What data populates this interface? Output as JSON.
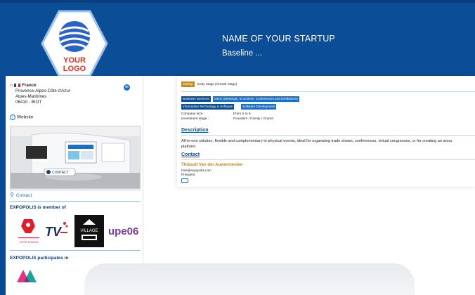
{
  "header": {
    "logo_text_line1": "YOUR",
    "logo_text_line2": "LOGO",
    "startup_name": "NAME OF YOUR STARTUP",
    "baseline": "Baseline ..."
  },
  "sidebar": {
    "country": "France",
    "region": "Provence-Alpes-Côte d'Azur",
    "department": "Alpes-Maritimes",
    "postcode_city": "06410 - BIOT",
    "linkedin_label": "in",
    "website_label": "Website",
    "stand_contact_label": "CONTACT",
    "contact_label": "Contact",
    "member_of_title": "EXPOPOLIS is member of",
    "participates_title": "EXPOPOLIS participates in",
    "member_logos": [
      {
        "name": "french-tech-cote-dazur-logo",
        "text": "CÔTE D'AZUR"
      },
      {
        "name": "tvt-logo",
        "text": "TV"
      },
      {
        "name": "village-by-ca-logo",
        "text": "VILLAGE"
      },
      {
        "name": "upe06-logo",
        "text": "upe06"
      }
    ]
  },
  "main": {
    "tags": {
      "startup": "Startup",
      "stage": "Early Stage (Growth Stage)",
      "business_services": "Business Services",
      "mice": "MICE (Meetings, Incentives, Conferences and Exhibitions)",
      "it_software": "Information Technology & Software",
      "software_dev": "Software Development"
    },
    "company_size_label": "Company size :",
    "company_size_value": "From 5 to 9",
    "investment_stage_label": "Investment stage :",
    "investment_stage_value": "Founders / Family / Grants",
    "description_title": "Description",
    "description_line1": "All-in-one solution, flexible and complementary to physical events, ideal for organizing trade shows, conferences, virtual congresses, or for creating an annu",
    "description_line2": "platform.",
    "contact_title": "Contact",
    "contact_name": "Thibault Van der Auwermeulen",
    "contact_email": "hola@expopolis.com",
    "contact_role": "Président"
  },
  "colors": {
    "header_blue": "#0b4d96",
    "logo_red": "#e0321e",
    "tag_gold": "#c98a1e",
    "tag_blue": "#1a6fc9",
    "tag_navy": "#0b4d96"
  }
}
